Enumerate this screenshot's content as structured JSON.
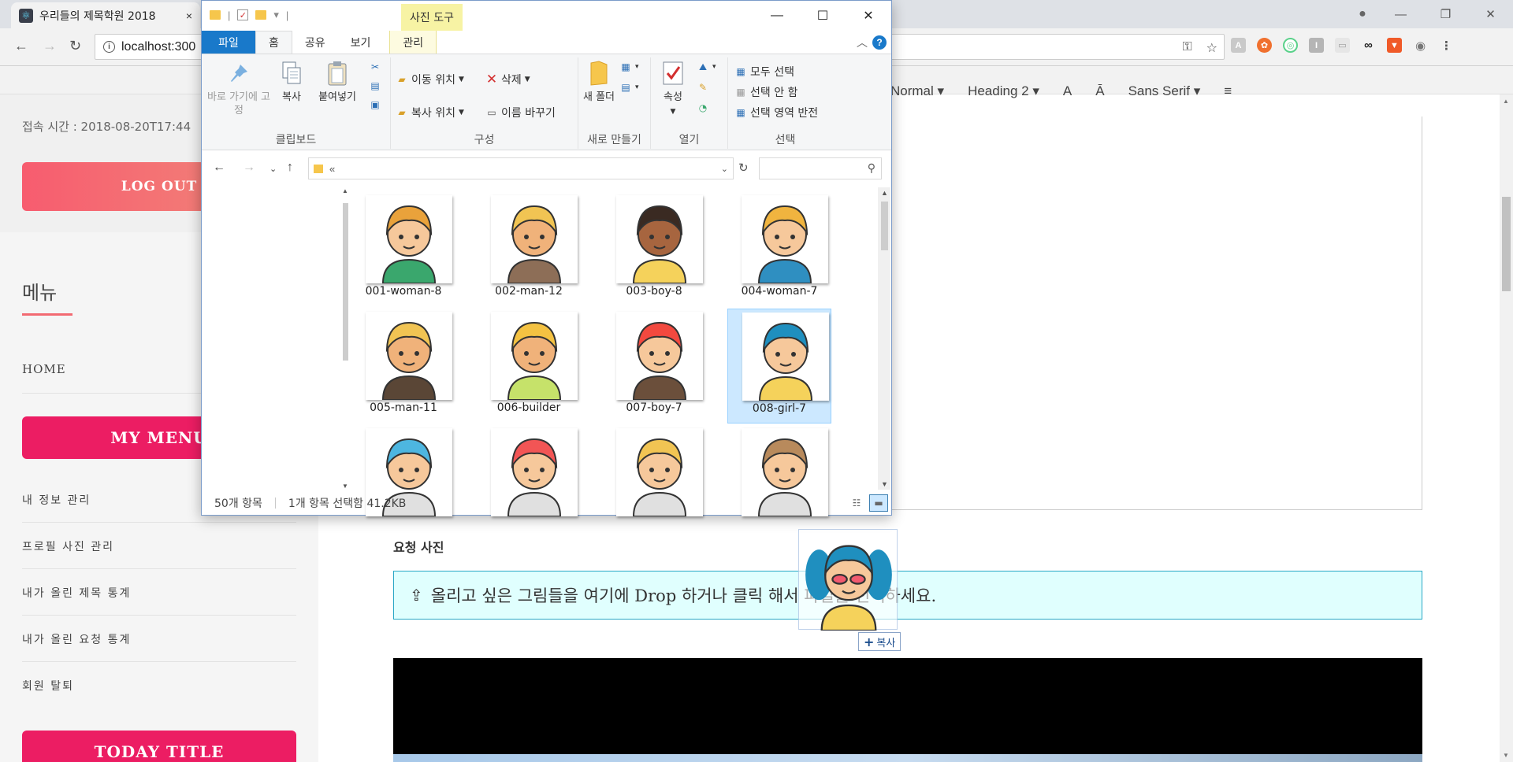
{
  "browser": {
    "tab_title": "우리들의 제목학원 2018",
    "tab_close": "×",
    "url": "localhost:300"
  },
  "page": {
    "access_time": "접속 시간 : 2018-08-20T17:44",
    "logout_label": "LOG OUT",
    "menu_heading": "메뉴",
    "home_label": "HOME",
    "my_menu_label": "MY MENU",
    "menu_items": [
      "내 정보 관리",
      "프로필 사진 관리",
      "내가 올린 제목 통계",
      "내가 올린 요청 통계",
      "회원 탈퇴"
    ],
    "today_title_label": "TODAY TITLE",
    "editor_toolbar": {
      "format": "Normal",
      "heading": "Heading 2",
      "font": "Sans Serif"
    },
    "request_photo_label": "요청 사진",
    "dropzone_text": "올리고 싶은 그림들을 여기에 Drop 하거나 클릭 해서 파일을 선택하세요.",
    "drag_tooltip": "복사"
  },
  "explorer": {
    "photo_tools_label": "사진 도구",
    "tabs": [
      "파일",
      "홈",
      "공유",
      "보기",
      "관리"
    ],
    "ribbon": {
      "pin_label": "바로 가기에 고정",
      "copy_label": "복사",
      "paste_label": "붙여넣기",
      "clipboard_group": "클립보드",
      "move_to": "이동 위치",
      "copy_to": "복사 위치",
      "delete": "삭제",
      "rename": "이름 바꾸기",
      "organize_group": "구성",
      "new_folder": "새 폴더",
      "new_group": "새로 만들기",
      "properties": "속성",
      "open_group": "열기",
      "select_all": "모두 선택",
      "select_none": "선택 안 함",
      "invert_selection": "선택 영역 반전",
      "select_group": "선택"
    },
    "address_text": "«",
    "files": [
      {
        "name": "001-woman-8",
        "hair": "#e9a23b",
        "skin": "#f6c89b",
        "shirt": "#3aa76d"
      },
      {
        "name": "002-man-12",
        "hair": "#f1c453",
        "skin": "#f0b27a",
        "shirt": "#8d6e57"
      },
      {
        "name": "003-boy-8",
        "hair": "#3a2a22",
        "skin": "#a7653f",
        "shirt": "#f5d25b"
      },
      {
        "name": "004-woman-7",
        "hair": "#f0b43f",
        "skin": "#f6c89b",
        "shirt": "#2f8fc1"
      },
      {
        "name": "005-man-11",
        "hair": "#f1c453",
        "skin": "#f0b27a",
        "shirt": "#5a4636"
      },
      {
        "name": "006-builder",
        "hair": "#f4c242",
        "skin": "#f0b27a",
        "shirt": "#c6e26a"
      },
      {
        "name": "007-boy-7",
        "hair": "#f2493f",
        "skin": "#f6c89b",
        "shirt": "#6b4f3b"
      },
      {
        "name": "008-girl-7",
        "hair": "#1f8fbf",
        "skin": "#f6c89b",
        "shirt": "#f5d25b"
      },
      {
        "name": "",
        "hair": "#4db6e0",
        "skin": "#f6c89b",
        "shirt": "#e0e0e0"
      },
      {
        "name": "",
        "hair": "#f25555",
        "skin": "#f6c89b",
        "shirt": "#e0e0e0"
      },
      {
        "name": "",
        "hair": "#f1c453",
        "skin": "#f6c89b",
        "shirt": "#e0e0e0"
      },
      {
        "name": "",
        "hair": "#b88a5c",
        "skin": "#f6c89b",
        "shirt": "#e0e0e0"
      }
    ],
    "selected_index": 7,
    "status_count": "50개 항목",
    "status_selected": "1개 항목 선택함 41.2KB"
  },
  "colors": {
    "accent_pink": "#ec1d63",
    "logout_coral": "#f75c6f",
    "ribbon_blue": "#1979ca",
    "dropzone_bg": "#e0fffe"
  }
}
